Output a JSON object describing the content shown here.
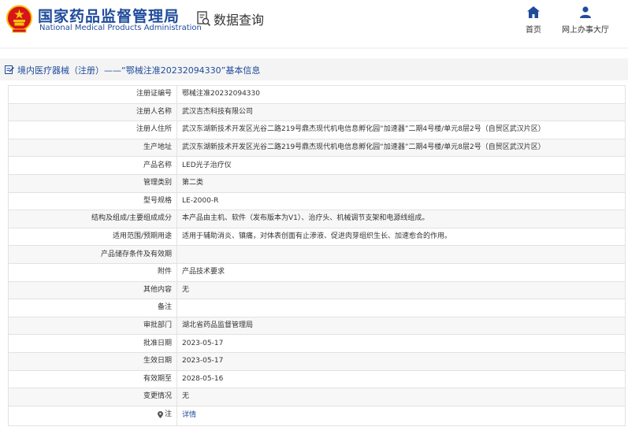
{
  "header": {
    "org_cn": "国家药品监督管理局",
    "org_en": "National Medical Products Administration",
    "query_label": "数据查询",
    "nav": [
      {
        "label": "首页",
        "icon": "home-icon"
      },
      {
        "label": "网上办事大厅",
        "icon": "user-icon"
      }
    ]
  },
  "title": "境内医疗器械（注册）——“鄂械注准20232094330”基本信息",
  "rows": [
    {
      "key": "注册证编号",
      "value": "鄂械注准20232094330"
    },
    {
      "key": "注册人名称",
      "value": "武汉吉杰科技有限公司"
    },
    {
      "key": "注册人住所",
      "value": "武汉东湖新技术开发区光谷二路219号鼎杰现代机电信息孵化园“加速器”二期4号楼/单元8层2号（自贸区武汉片区）"
    },
    {
      "key": "生产地址",
      "value": "武汉东湖新技术开发区光谷二路219号鼎杰现代机电信息孵化园“加速器”二期4号楼/单元8层2号（自贸区武汉片区）"
    },
    {
      "key": "产品名称",
      "value": "LED光子治疗仪"
    },
    {
      "key": "管理类别",
      "value": "第二类"
    },
    {
      "key": "型号规格",
      "value": "LE-2000-R"
    },
    {
      "key": "结构及组成/主要组成成分",
      "value": "本产品由主机、软件（发布版本为V1）、治疗头、机械调节支架和电源线组成。"
    },
    {
      "key": "适用范围/预期用途",
      "value": "适用于辅助消炎、镇痛，对体表创面有止渗液、促进肉芽组织生长、加速愈合的作用。"
    },
    {
      "key": "产品储存条件及有效期",
      "value": ""
    },
    {
      "key": "附件",
      "value": "产品技术要求"
    },
    {
      "key": "其他内容",
      "value": "无"
    },
    {
      "key": "备注",
      "value": ""
    },
    {
      "key": "审批部门",
      "value": "湖北省药品监督管理局"
    },
    {
      "key": "批准日期",
      "value": "2023-05-17"
    },
    {
      "key": "生效日期",
      "value": "2023-05-17"
    },
    {
      "key": "有效期至",
      "value": "2028-05-16"
    },
    {
      "key": "变更情况",
      "value": "无"
    }
  ],
  "note": {
    "key": "注",
    "link": "详情"
  },
  "colors": {
    "brand": "#1f4b9b",
    "emblem_red": "#d7141a",
    "emblem_gold": "#f4c20d"
  }
}
